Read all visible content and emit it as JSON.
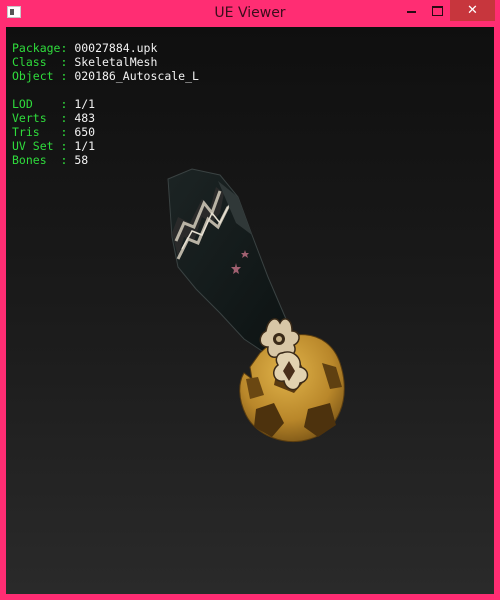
{
  "window": {
    "title": "UE Viewer",
    "controls": {
      "minimize": "minimize",
      "maximize": "maximize",
      "close": "✕"
    }
  },
  "stats": {
    "object_info": [
      {
        "label": "Package: ",
        "value": "00027884.upk"
      },
      {
        "label": "Class  : ",
        "value": "SkeletalMesh"
      },
      {
        "label": "Object : ",
        "value": "020186_Autoscale_L"
      }
    ],
    "mesh_info": [
      {
        "label": "LOD    : ",
        "value": "1/1"
      },
      {
        "label": "Verts  : ",
        "value": "483"
      },
      {
        "label": "Tris   : ",
        "value": "650"
      },
      {
        "label": "UV Set : ",
        "value": "1/1"
      },
      {
        "label": "Bones  : ",
        "value": "58"
      }
    ]
  },
  "colors": {
    "window_frame": "#ff2d73",
    "close_button": "#c7363d",
    "label_green": "#2fdc3c",
    "value_white": "#f2f2f2"
  }
}
